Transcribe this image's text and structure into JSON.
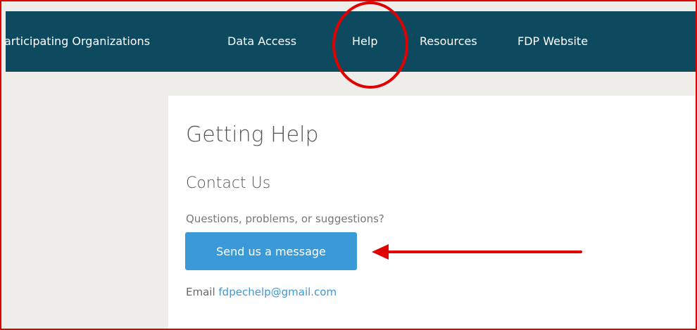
{
  "nav": {
    "items": [
      {
        "label": "articipating Organizations"
      },
      {
        "label": "Data Access"
      },
      {
        "label": "Help"
      },
      {
        "label": "Resources"
      },
      {
        "label": "FDP Website"
      }
    ]
  },
  "main": {
    "page_title": "Getting Help",
    "section_heading": "Contact Us",
    "prompt": "Questions, problems, or suggestions?",
    "send_button_label": "Send us a message",
    "email_label": "Email",
    "email_address": "fdpechelp@gmail.com"
  },
  "colors": {
    "navbar": "#0d4a60",
    "button": "#3a9ad8",
    "annotation": "#e10000",
    "background": "#efede9"
  }
}
